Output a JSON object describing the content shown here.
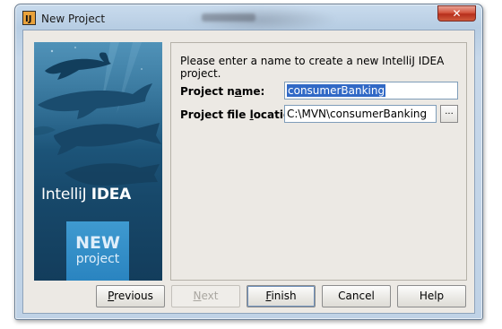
{
  "window": {
    "title": "New Project",
    "close_label": "✕"
  },
  "banner": {
    "brand_plain": "IntelliJ",
    "brand_bold": "IDEA",
    "badge_line1": "NEW",
    "badge_line2": "project"
  },
  "form": {
    "prompt": "Please enter a name to create a new IntelliJ IDEA project.",
    "name_label_pre": "Project n",
    "name_label_u": "a",
    "name_label_post": "me:",
    "name_value": "consumerBanking",
    "location_label_pre": "Project file ",
    "location_label_u": "l",
    "location_label_post": "ocation:",
    "location_value": "C:\\MVN\\consumerBanking",
    "browse_label": "..."
  },
  "buttons": {
    "previous_u": "P",
    "previous_rest": "revious",
    "next_u": "N",
    "next_rest": "ext",
    "finish_u": "F",
    "finish_rest": "inish",
    "cancel": "Cancel",
    "help": "Help"
  },
  "colors": {
    "selection": "#3169c6",
    "banner_blue": "#1f5a80",
    "window_frame": "#bfd2e6"
  }
}
